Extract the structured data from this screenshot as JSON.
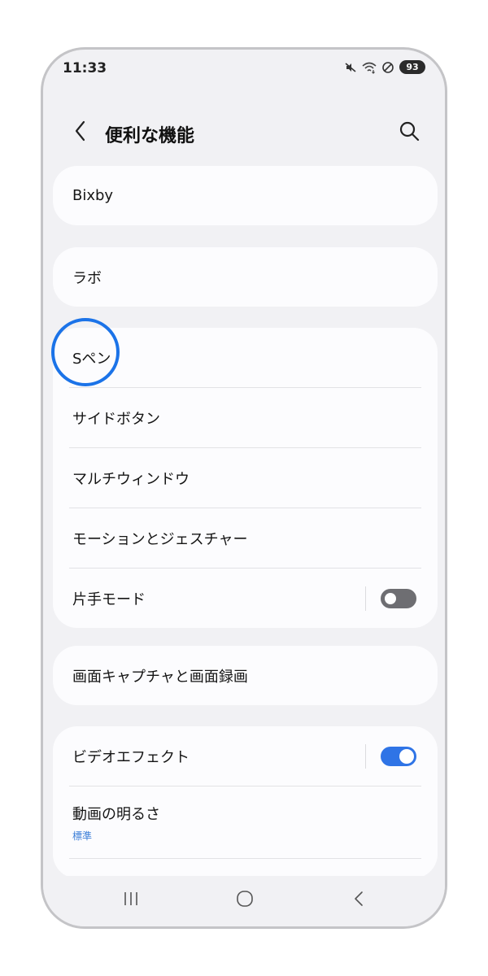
{
  "status_bar": {
    "time": "11:33",
    "battery": "93",
    "icons": [
      "mute-icon",
      "wifi-icon",
      "do-not-disturb-icon",
      "battery-icon"
    ]
  },
  "header": {
    "title": "便利な機能",
    "back_icon": "chevron-left-icon",
    "search_icon": "search-icon"
  },
  "sections": {
    "bixby": {
      "label": "Bixby"
    },
    "labs": {
      "label": "ラボ"
    },
    "group_main": {
      "items": [
        {
          "label": "Sペン"
        },
        {
          "label": "サイドボタン"
        },
        {
          "label": "マルチウィンドウ"
        },
        {
          "label": "モーションとジェスチャー"
        },
        {
          "label": "片手モード",
          "toggle": false
        }
      ]
    },
    "capture": {
      "label": "画面キャプチャと画面録画"
    },
    "group_video": {
      "items": [
        {
          "label": "ビデオエフェクト",
          "toggle": true
        },
        {
          "label": "動画の明るさ",
          "sub": "標準"
        }
      ]
    }
  },
  "nav_bar": {
    "icons": [
      "recent-apps-icon",
      "home-icon",
      "back-icon"
    ]
  },
  "colors": {
    "accent": "#2f74e6",
    "highlight": "#1b73e8",
    "background": "#f1f1f4",
    "card": "#fcfcfe"
  }
}
